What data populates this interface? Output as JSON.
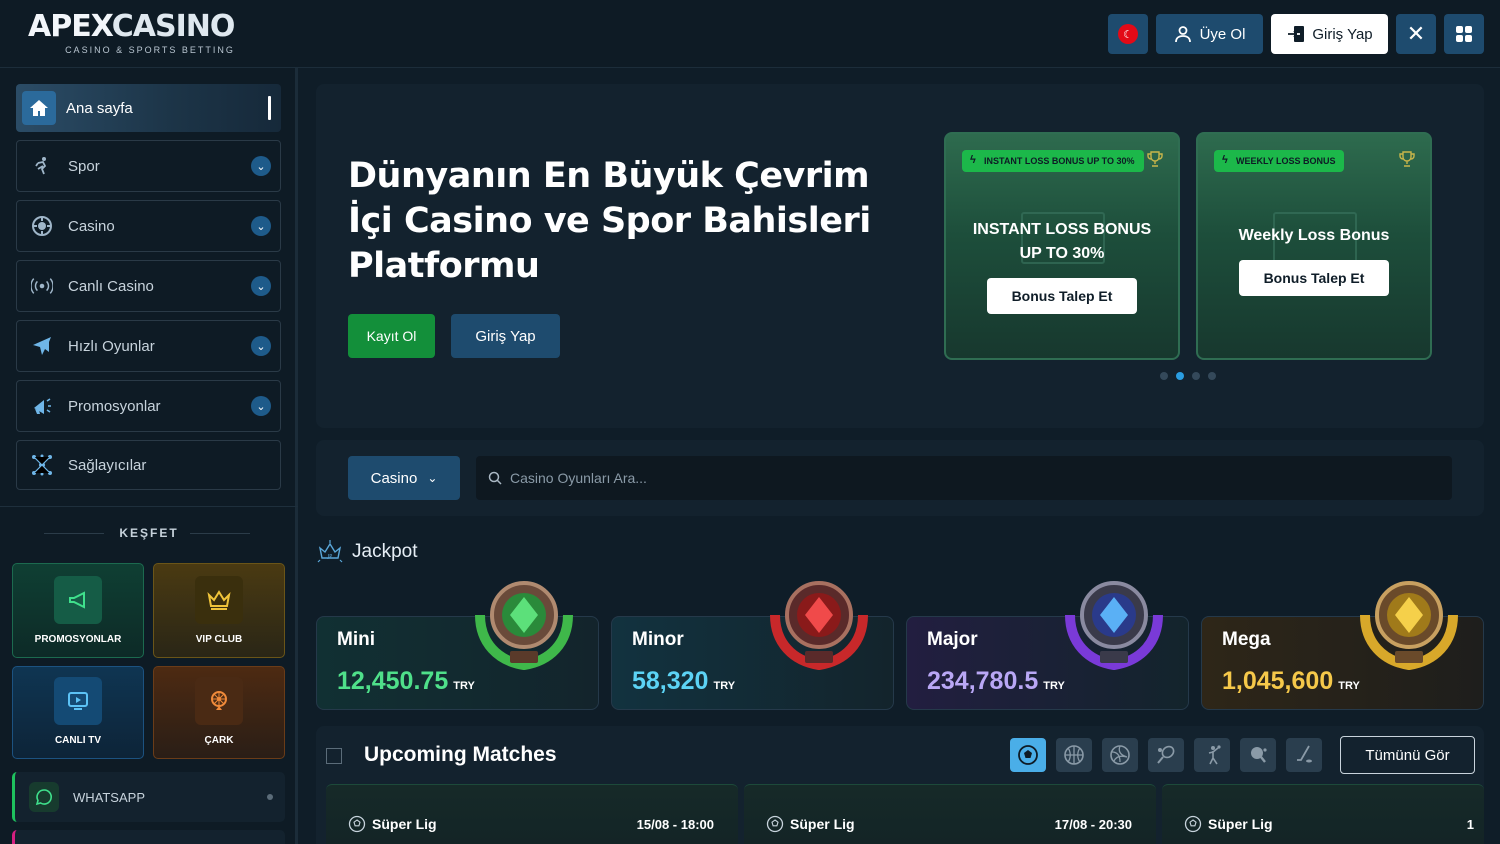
{
  "header": {
    "logo_main_1": "APEX",
    "logo_main_2": "CASINO",
    "logo_sub": "CASINO & SPORTS BETTING",
    "signup_label": "Üye Ol",
    "login_label": "Giriş Yap"
  },
  "sidebar": {
    "items": [
      {
        "label": "Ana sayfa",
        "icon": "home-icon"
      },
      {
        "label": "Spor",
        "icon": "sport-icon"
      },
      {
        "label": "Casino",
        "icon": "casino-chip-icon"
      },
      {
        "label": "Canlı Casino",
        "icon": "live-broadcast-icon"
      },
      {
        "label": "Hızlı Oyunlar",
        "icon": "plane-icon"
      },
      {
        "label": "Promosyonlar",
        "icon": "megaphone-icon"
      },
      {
        "label": "Sağlayıcılar",
        "icon": "network-icon"
      }
    ],
    "section_title": "KEŞFET",
    "tiles": [
      "PROMOSYONLAR",
      "VIP CLUB",
      "CANLI TV",
      "ÇARK"
    ],
    "whatsapp": "WHATSAPP"
  },
  "hero": {
    "title": "Dünyanın En Büyük Çevrim İçi Casino ve Spor Bahisleri Platformu",
    "register_label": "Kayıt Ol",
    "login_label": "Giriş Yap",
    "promos": [
      {
        "tag": "INSTANT LOSS BONUS UP TO 30%",
        "name": "INSTANT LOSS BONUS UP TO 30%",
        "button": "Bonus Talep Et"
      },
      {
        "tag": "WEEKLY LOSS BONUS",
        "name": "Weekly Loss Bonus",
        "button": "Bonus Talep Et"
      }
    ]
  },
  "search": {
    "category": "Casino",
    "placeholder": "Casino Oyunları Ara..."
  },
  "jackpot": {
    "title": "Jackpot",
    "currency": "TRY",
    "tiers": [
      {
        "name": "Mini",
        "value": "12,450.75",
        "color": "#4fe08a"
      },
      {
        "name": "Minor",
        "value": "58,320",
        "color": "#5cd3f5"
      },
      {
        "name": "Major",
        "value": "234,780.5",
        "color": "#b9a7f5"
      },
      {
        "name": "Mega",
        "value": "1,045,600",
        "color": "#f5c84a"
      }
    ]
  },
  "upcoming": {
    "title": "Upcoming Matches",
    "all_label": "Tümünü Gör",
    "sports": [
      "soccer-icon",
      "basketball-icon",
      "volleyball-icon",
      "tennis-icon",
      "handball-icon",
      "table-tennis-icon",
      "hockey-icon"
    ],
    "matches": [
      {
        "league": "Süper Lig",
        "time": "15/08 - 18:00"
      },
      {
        "league": "Süper Lig",
        "time": "17/08 - 20:30"
      },
      {
        "league": "Süper Lig",
        "time": "1"
      }
    ]
  }
}
